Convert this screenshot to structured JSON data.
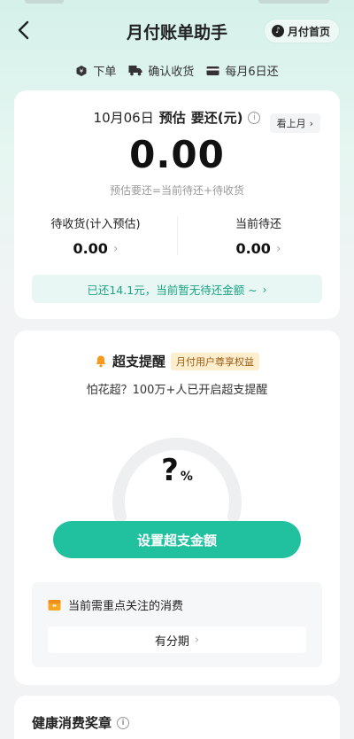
{
  "nav": {
    "title": "月付账单助手",
    "home_label": "月付首页"
  },
  "steps": [
    {
      "label": "下单",
      "icon": "order-icon"
    },
    {
      "label": "确认收货",
      "icon": "truck-icon"
    },
    {
      "label": "每月6日还",
      "icon": "card-icon"
    }
  ],
  "bill": {
    "date": "10月06日",
    "estimate": "预估",
    "due_label": "要还(元)",
    "last_month": "看上月",
    "amount": "0.00",
    "formula": "预估要还=当前待还+待收货",
    "pending_receipt_label": "待收货(计入预估)",
    "pending_receipt_value": "0.00",
    "current_due_label": "当前待还",
    "current_due_value": "0.00",
    "notice": "已还14.1元，当前暂无待还金额 ~"
  },
  "reminder": {
    "title": "超支提醒",
    "badge": "月付用户尊享权益",
    "subtitle": "怕花超？100万+人已开启超支提醒",
    "gauge_value": "?",
    "gauge_unit": "%",
    "cta": "设置超支金额",
    "focus_title": "当前需重点关注的消费",
    "focus_button": "有分期"
  },
  "health": {
    "title": "健康消费奖章"
  },
  "colors": {
    "accent": "#21c1a0",
    "notice_text": "#1aa383",
    "badge_bg": "#fdeecd"
  }
}
